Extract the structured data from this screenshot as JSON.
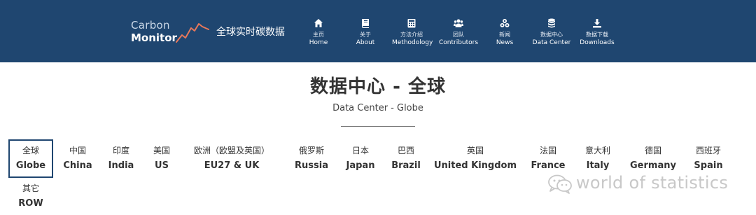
{
  "header": {
    "logo_line1": "Carbon",
    "logo_line2": "Monitor",
    "logo_subtitle": "全球实时碳数据",
    "nav": [
      {
        "zh": "主页",
        "en": "Home",
        "icon": "home-icon"
      },
      {
        "zh": "关于",
        "en": "About",
        "icon": "book-icon"
      },
      {
        "zh": "方法介绍",
        "en": "Methodology",
        "icon": "calculator-icon"
      },
      {
        "zh": "团队",
        "en": "Contributors",
        "icon": "users-icon"
      },
      {
        "zh": "新闻",
        "en": "News",
        "icon": "cubes-icon"
      },
      {
        "zh": "数据中心",
        "en": "Data Center",
        "icon": "database-icon"
      },
      {
        "zh": "数据下载",
        "en": "Downloads",
        "icon": "download-icon"
      }
    ]
  },
  "main": {
    "title": "数据中心 - 全球",
    "subtitle": "Data Center - Globe",
    "regions": [
      {
        "zh": "全球",
        "en": "Globe",
        "active": true
      },
      {
        "zh": "中国",
        "en": "China"
      },
      {
        "zh": "印度",
        "en": "India"
      },
      {
        "zh": "美国",
        "en": "US"
      },
      {
        "zh": "欧洲（欧盟及英国）",
        "en": "EU27 & UK"
      },
      {
        "zh": "俄罗斯",
        "en": "Russia"
      },
      {
        "zh": "日本",
        "en": "Japan"
      },
      {
        "zh": "巴西",
        "en": "Brazil"
      },
      {
        "zh": "英国",
        "en": "United Kingdom"
      },
      {
        "zh": "法国",
        "en": "France"
      },
      {
        "zh": "意大利",
        "en": "Italy"
      },
      {
        "zh": "德国",
        "en": "Germany"
      },
      {
        "zh": "西班牙",
        "en": "Spain"
      },
      {
        "zh": "其它",
        "en": "ROW"
      }
    ]
  },
  "watermark": {
    "text": "world of statistics",
    "icon": "wechat-icon"
  },
  "colors": {
    "header_bg": "#1f4670",
    "logo_chart": "#e8785a",
    "active_border": "#1f4670"
  }
}
